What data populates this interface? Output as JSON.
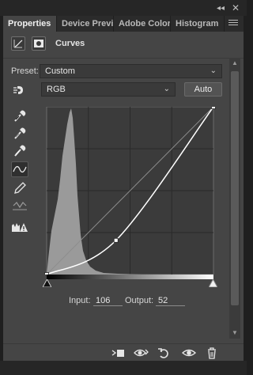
{
  "window": {
    "collapse_icon": "double-chevron-icon",
    "close_icon": "close-icon",
    "close_glyph": "✕",
    "collapse_glyph": "◂◂"
  },
  "tabs": [
    {
      "label": "Properties",
      "active": true
    },
    {
      "label": "Device Preview",
      "active": false
    },
    {
      "label": "Adobe Color T",
      "active": false
    },
    {
      "label": "Histogram",
      "active": false
    }
  ],
  "header": {
    "title": "Curves",
    "icons": [
      "adjustment-curves-icon",
      "mask-icon"
    ]
  },
  "preset": {
    "label": "Preset:",
    "value": "Custom"
  },
  "channel": {
    "value": "RGB",
    "auto_label": "Auto"
  },
  "tools": [
    "on-image-adjust-icon",
    "black-point-eyedropper-icon",
    "gray-point-eyedropper-icon",
    "white-point-eyedropper-icon",
    "edit-points-curve-icon",
    "pencil-draw-icon",
    "smooth-curve-icon",
    "clipping-warning-icon"
  ],
  "curve": {
    "input_label": "Input:",
    "input_value": "106",
    "output_label": "Output:",
    "output_value": "52",
    "points": [
      [
        0,
        0
      ],
      [
        106,
        52
      ],
      [
        255,
        255
      ]
    ]
  },
  "bottom_icons": [
    "clip-to-layer-icon",
    "view-previous-state-icon",
    "reset-icon",
    "toggle-visibility-icon",
    "trash-icon"
  ],
  "colors": {
    "panel": "#454545",
    "graph_bg": "#3b3b3b",
    "histogram": "#9a9a9a",
    "curve": "#ffffff",
    "accent_border": "#6f6f6f"
  }
}
